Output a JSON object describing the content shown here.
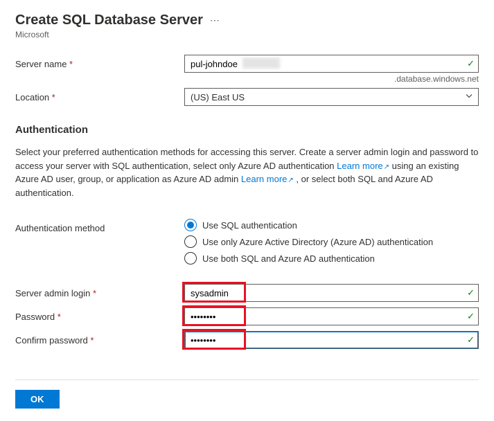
{
  "header": {
    "title": "Create SQL Database Server",
    "subtitle": "Microsoft"
  },
  "form": {
    "serverName": {
      "label": "Server name",
      "value": "pul-johndoe",
      "suffix": ".database.windows.net"
    },
    "location": {
      "label": "Location",
      "value": "(US) East US"
    }
  },
  "auth": {
    "heading": "Authentication",
    "desc_pre": "Select your preferred authentication methods for accessing this server. Create a server admin login and password to access your server with SQL authentication, select only Azure AD authentication ",
    "learn1": "Learn more",
    "desc_mid": " using an existing Azure AD user, group, or application as Azure AD admin ",
    "learn2": "Learn more",
    "desc_post": " , or select both SQL and Azure AD authentication.",
    "methodLabel": "Authentication method",
    "options": [
      "Use SQL authentication",
      "Use only Azure Active Directory (Azure AD) authentication",
      "Use both SQL and Azure AD authentication"
    ]
  },
  "admin": {
    "loginLabel": "Server admin login",
    "loginValue": "sysadmin",
    "passwordLabel": "Password",
    "passwordValue": "••••••••",
    "confirmLabel": "Confirm password",
    "confirmValue": "••••••••"
  },
  "footer": {
    "ok": "OK"
  }
}
